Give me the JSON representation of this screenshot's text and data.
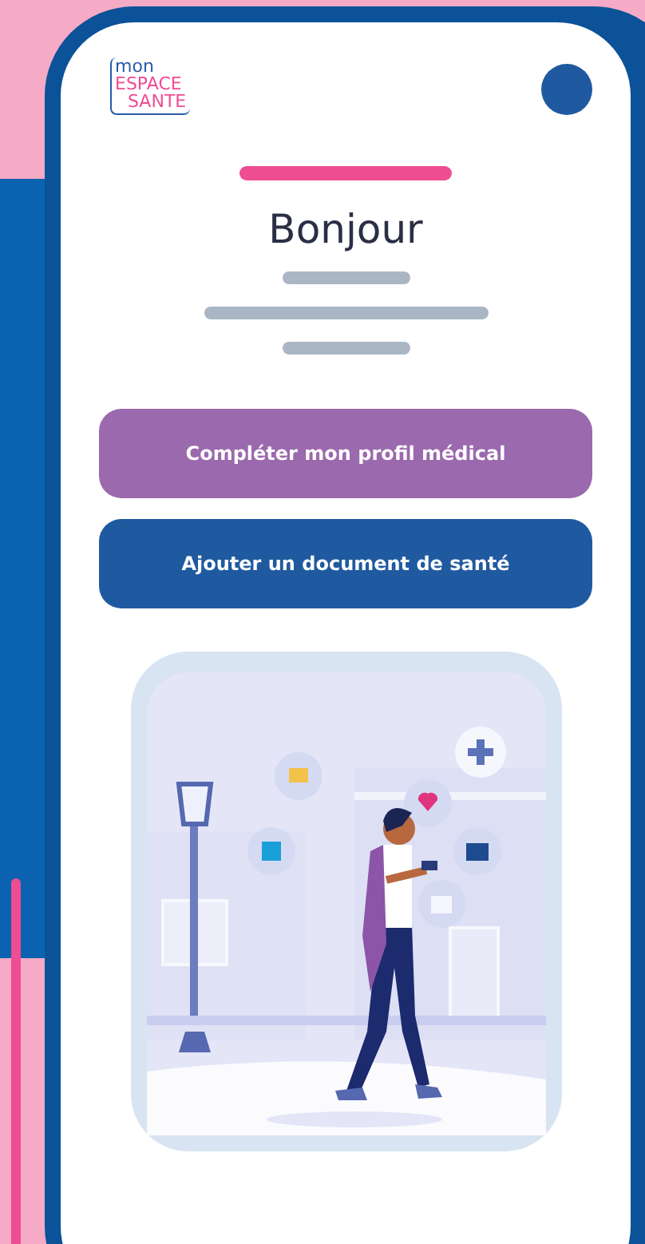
{
  "logo": {
    "line_1": "mon",
    "line_2": "ESPACE",
    "line_3": "SANTE"
  },
  "greeting": "Bonjour",
  "buttons": [
    {
      "label": "Compléter mon profil médical",
      "kind": "primary"
    },
    {
      "label": "Ajouter un document de santé",
      "kind": "secondary"
    }
  ]
}
